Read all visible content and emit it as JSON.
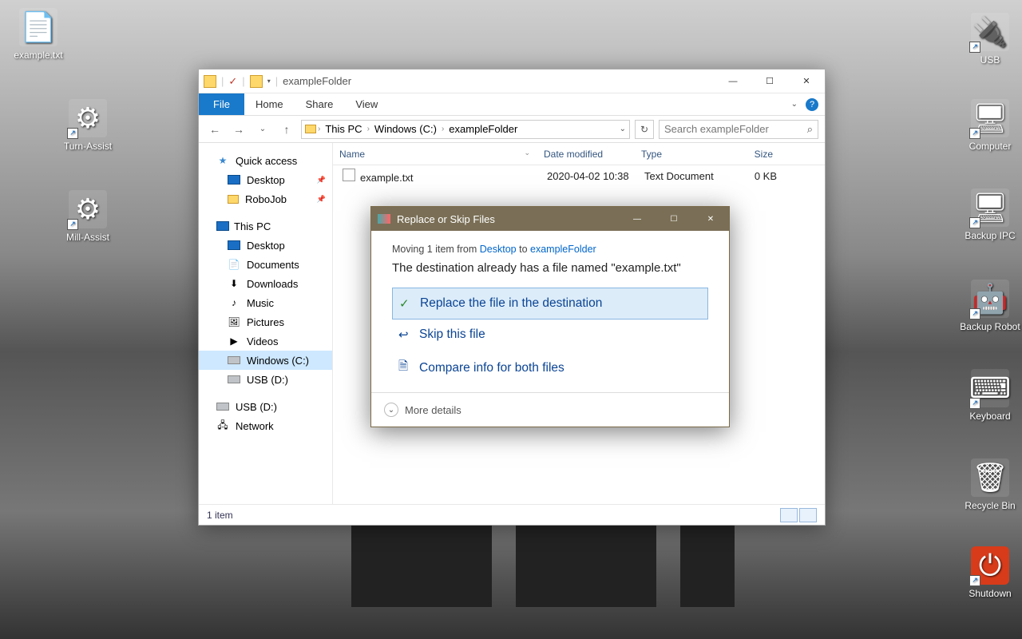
{
  "desktop": {
    "left_icons": [
      {
        "label": "example.txt",
        "name": "desktop-file-example"
      },
      {
        "label": "Turn-Assist",
        "name": "desktop-turn-assist"
      },
      {
        "label": "Mill-Assist",
        "name": "desktop-mill-assist"
      }
    ],
    "right_icons": [
      {
        "label": "USB",
        "name": "desktop-usb"
      },
      {
        "label": "Computer",
        "name": "desktop-computer"
      },
      {
        "label": "Backup IPC",
        "name": "desktop-backup-ipc"
      },
      {
        "label": "Backup Robot",
        "name": "desktop-backup-robot"
      },
      {
        "label": "Keyboard",
        "name": "desktop-keyboard"
      },
      {
        "label": "Recycle Bin",
        "name": "desktop-recycle-bin"
      },
      {
        "label": "Shutdown",
        "name": "desktop-shutdown"
      }
    ]
  },
  "explorer": {
    "title": "exampleFolder",
    "ribbon": {
      "file": "File",
      "tabs": [
        "Home",
        "Share",
        "View"
      ]
    },
    "breadcrumbs": [
      "This PC",
      "Windows (C:)",
      "exampleFolder"
    ],
    "search_placeholder": "Search exampleFolder",
    "nav": {
      "quick_access": "Quick access",
      "qa_items": [
        {
          "label": "Desktop",
          "pinned": true
        },
        {
          "label": "RoboJob",
          "pinned": true
        }
      ],
      "this_pc": "This PC",
      "pc_items": [
        "Desktop",
        "Documents",
        "Downloads",
        "Music",
        "Pictures",
        "Videos",
        "Windows (C:)",
        "USB (D:)"
      ],
      "extra": [
        "USB (D:)",
        "Network"
      ]
    },
    "columns": {
      "name": "Name",
      "date": "Date modified",
      "type": "Type",
      "size": "Size"
    },
    "files": [
      {
        "name": "example.txt",
        "date": "2020-04-02 10:38",
        "type": "Text Document",
        "size": "0 KB"
      }
    ],
    "status": "1 item"
  },
  "dialog": {
    "title": "Replace or Skip Files",
    "moving_prefix": "Moving 1 item from ",
    "moving_from": "Desktop",
    "moving_to_word": " to ",
    "moving_to": "exampleFolder",
    "message": "The destination already has a file named \"example.txt\"",
    "options": {
      "replace": "Replace the file in the destination",
      "skip": "Skip this file",
      "compare": "Compare info for both files"
    },
    "more_details": "More details"
  }
}
